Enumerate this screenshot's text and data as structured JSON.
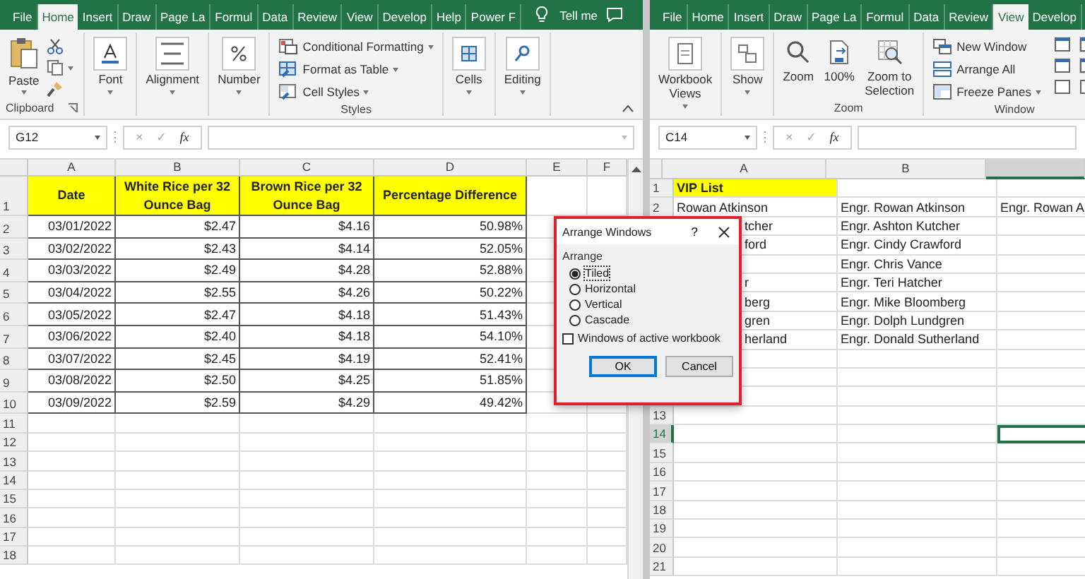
{
  "left_window": {
    "tabs": [
      {
        "label": "File",
        "selected": false
      },
      {
        "label": "Home",
        "selected": true
      },
      {
        "label": "Insert",
        "selected": false
      },
      {
        "label": "Draw",
        "selected": false
      },
      {
        "label": "Page La",
        "selected": false
      },
      {
        "label": "Formul",
        "selected": false
      },
      {
        "label": "Data",
        "selected": false
      },
      {
        "label": "Review",
        "selected": false
      },
      {
        "label": "View",
        "selected": false
      },
      {
        "label": "Develop",
        "selected": false
      },
      {
        "label": "Help",
        "selected": false
      },
      {
        "label": "Power F",
        "selected": false
      }
    ],
    "tell_me": "Tell me",
    "ribbon": [
      {
        "kind": "clipboard",
        "label": "Clipboard",
        "items": [
          {
            "label": "Paste",
            "dropdown": true
          }
        ]
      },
      {
        "kind": "big",
        "items": [
          {
            "kind": "font",
            "label": "Font",
            "dropdown": true
          }
        ]
      },
      {
        "kind": "big",
        "items": [
          {
            "kind": "alignment",
            "label": "Alignment",
            "dropdown": true
          }
        ]
      },
      {
        "kind": "big",
        "items": [
          {
            "kind": "number",
            "label": "Number",
            "dropdown": true
          }
        ]
      },
      {
        "kind": "list",
        "label": "Styles",
        "items": [
          {
            "kind": "cond",
            "label": "Conditional Formatting",
            "dropdown": true
          },
          {
            "kind": "table",
            "label": "Format as Table",
            "dropdown": true
          },
          {
            "kind": "cellstyles",
            "label": "Cell Styles",
            "dropdown": true
          }
        ]
      },
      {
        "kind": "big",
        "items": [
          {
            "kind": "cells",
            "label": "Cells",
            "dropdown": true
          }
        ]
      },
      {
        "kind": "big",
        "items": [
          {
            "kind": "editing",
            "label": "Editing",
            "dropdown": true
          }
        ]
      }
    ],
    "formula_bar": {
      "name_box": "G12",
      "cancel": "×",
      "enter": "✓",
      "function": "fx"
    },
    "sheet": {
      "columns": [
        "A",
        "B",
        "C",
        "D",
        "E",
        "F"
      ],
      "rows": [
        {
          "num": "1",
          "kind": "header",
          "cells": [
            "Date",
            "White Rice per 32 Ounce Bag",
            "Brown Rice per 32 Ounce Bag",
            "Percentage Difference"
          ]
        },
        {
          "num": "2",
          "kind": "data",
          "cells": [
            "03/01/2022",
            "$2.47",
            "$4.16",
            "50.98%"
          ]
        },
        {
          "num": "3",
          "kind": "data",
          "cells": [
            "03/02/2022",
            "$2.43",
            "$4.14",
            "52.05%"
          ]
        },
        {
          "num": "4",
          "kind": "data",
          "cells": [
            "03/03/2022",
            "$2.49",
            "$4.28",
            "52.88%"
          ]
        },
        {
          "num": "5",
          "kind": "data",
          "cells": [
            "03/04/2022",
            "$2.55",
            "$4.26",
            "50.22%"
          ]
        },
        {
          "num": "6",
          "kind": "data",
          "cells": [
            "03/05/2022",
            "$2.47",
            "$4.18",
            "51.43%"
          ]
        },
        {
          "num": "7",
          "kind": "data",
          "cells": [
            "03/06/2022",
            "$2.40",
            "$4.18",
            "54.10%"
          ]
        },
        {
          "num": "8",
          "kind": "data",
          "cells": [
            "03/07/2022",
            "$2.45",
            "$4.19",
            "52.41%"
          ]
        },
        {
          "num": "9",
          "kind": "data",
          "cells": [
            "03/08/2022",
            "$2.50",
            "$4.25",
            "51.85%"
          ]
        },
        {
          "num": "10",
          "kind": "data",
          "cells": [
            "03/09/2022",
            "$2.59",
            "$4.29",
            "49.42%"
          ]
        },
        {
          "num": "11",
          "kind": "empty"
        },
        {
          "num": "12",
          "kind": "empty"
        },
        {
          "num": "13",
          "kind": "empty"
        },
        {
          "num": "14",
          "kind": "empty"
        },
        {
          "num": "15",
          "kind": "empty"
        },
        {
          "num": "16",
          "kind": "empty"
        },
        {
          "num": "17",
          "kind": "empty"
        },
        {
          "num": "18",
          "kind": "empty"
        }
      ]
    }
  },
  "right_window": {
    "tabs": [
      {
        "label": "File",
        "selected": false
      },
      {
        "label": "Home",
        "selected": false
      },
      {
        "label": "Insert",
        "selected": false
      },
      {
        "label": "Draw",
        "selected": false
      },
      {
        "label": "Page La",
        "selected": false
      },
      {
        "label": "Formul",
        "selected": false
      },
      {
        "label": "Data",
        "selected": false
      },
      {
        "label": "Review",
        "selected": false
      },
      {
        "label": "View",
        "selected": true
      },
      {
        "label": "Develop",
        "selected": false
      }
    ],
    "ribbon": [
      {
        "kind": "big",
        "items": [
          {
            "kind": "views",
            "label": "Workbook Views",
            "dropdown": true
          }
        ]
      },
      {
        "kind": "big",
        "items": [
          {
            "kind": "show",
            "label": "Show",
            "dropdown": true
          }
        ]
      },
      {
        "kind": "big",
        "label": "Zoom",
        "items": [
          {
            "kind": "zoom",
            "label": "Zoom",
            "dropdown": false
          },
          {
            "kind": "zoom100",
            "label": "100%",
            "dropdown": false
          },
          {
            "kind": "zoomsel",
            "label": "Zoom to Selection",
            "dropdown": false
          }
        ]
      },
      {
        "kind": "window",
        "label": "Window",
        "items": [
          {
            "kind": "newwin",
            "label": "New Window",
            "dropdown": false
          },
          {
            "kind": "arrange",
            "label": "Arrange All",
            "dropdown": false
          },
          {
            "kind": "freeze",
            "label": "Freeze Panes",
            "dropdown": true
          }
        ]
      }
    ],
    "formula_bar": {
      "name_box": "C14",
      "cancel": "×",
      "enter": "✓",
      "function": "fx"
    },
    "sheet": {
      "columns": [
        {
          "label": "A",
          "selected": false
        },
        {
          "label": "B",
          "selected": false
        },
        {
          "selected": true
        }
      ],
      "rows": [
        {
          "num": "1",
          "kind": "header",
          "selected": false,
          "a": "VIP List"
        },
        {
          "num": "2",
          "selected": false,
          "a": "Rowan Atkinson",
          "b": "Engr. Rowan Atkinson",
          "c": "Engr. Rowan A"
        },
        {
          "clipped": true,
          "a": "tcher",
          "b": "Engr. Ashton Kutcher"
        },
        {
          "clipped": true,
          "a": "ford",
          "b": "Engr. Cindy Crawford"
        },
        {
          "b": "Engr. Chris Vance"
        },
        {
          "clipped": true,
          "a": "r",
          "b": "Engr. Teri Hatcher"
        },
        {
          "clipped": true,
          "a": "berg",
          "b": "Engr. Mike Bloomberg"
        },
        {
          "clipped": true,
          "a": "gren",
          "b": "Engr. Dolph Lundgren"
        },
        {
          "clipped": true,
          "a": "herland",
          "b": "Engr. Donald Sutherland"
        },
        {},
        {},
        {},
        {
          "num": "13",
          "selected": false
        },
        {
          "num": "14",
          "selected": true
        },
        {
          "num": "15",
          "selected": false
        },
        {
          "num": "16",
          "selected": false
        },
        {
          "num": "17",
          "selected": false
        },
        {
          "num": "18",
          "selected": false
        },
        {
          "num": "19",
          "selected": false
        },
        {
          "num": "20",
          "selected": false
        },
        {
          "num": "21",
          "selected": false
        }
      ]
    }
  },
  "dialog": {
    "title": "Arrange Windows",
    "help": "?",
    "group_label": "Arrange",
    "options": [
      {
        "label": "Tiled",
        "selected": true
      },
      {
        "label": "Horizontal",
        "selected": false
      },
      {
        "label": "Vertical",
        "selected": false
      },
      {
        "label": "Cascade",
        "selected": false
      }
    ],
    "checkbox": {
      "label": "Windows of active workbook",
      "checked": false
    },
    "buttons": [
      {
        "label": "OK",
        "kind": "primary"
      },
      {
        "label": "Cancel",
        "kind": "secondary"
      }
    ]
  }
}
